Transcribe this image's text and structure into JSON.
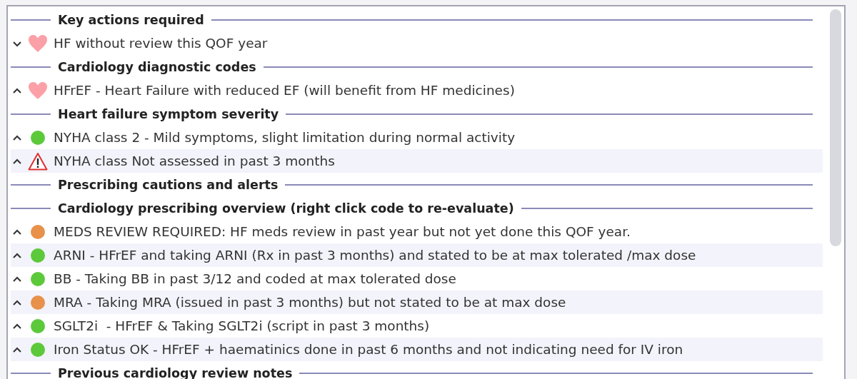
{
  "sections": [
    {
      "title": "Key actions required",
      "items": [
        {
          "text": "HF without review this QOF year",
          "expanded": false,
          "kind": "heart"
        }
      ]
    },
    {
      "title": "Cardiology diagnostic codes",
      "items": [
        {
          "text": "HFrEF - Heart Failure with reduced EF (will benefit from HF medicines)",
          "expanded": true,
          "kind": "heart"
        }
      ]
    },
    {
      "title": "Heart failure symptom severity",
      "items": [
        {
          "text": "NYHA class 2 - Mild symptoms, slight limitation during normal activity",
          "expanded": true,
          "kind": "dot",
          "color": "#5cc93a"
        },
        {
          "text": "NYHA class Not assessed in past 3 months",
          "expanded": true,
          "kind": "warning"
        }
      ]
    },
    {
      "title": "Prescribing cautions and alerts"
    },
    {
      "title": "Cardiology prescribing overview (right click code to re-evaluate)",
      "items": [
        {
          "text": "MEDS REVIEW REQUIRED: HF meds review in past year but not yet done this QOF year.",
          "expanded": true,
          "kind": "dot",
          "color": "#e8914a"
        },
        {
          "text": "ARNI - HFrEF and taking ARNI (Rx in past 3 months) and stated to be at max tolerated /max dose",
          "expanded": true,
          "kind": "dot",
          "color": "#5cc93a"
        },
        {
          "text": "BB - Taking BB in past 3/12 and coded at max tolerated dose",
          "expanded": true,
          "kind": "dot",
          "color": "#5cc93a"
        },
        {
          "text": "MRA - Taking MRA (issued in past 3 months) but not stated to be at max dose",
          "expanded": true,
          "kind": "dot",
          "color": "#e8914a"
        },
        {
          "text": "SGLT2i  - HFrEF & Taking SGLT2i (script in past 3 months)",
          "expanded": true,
          "kind": "dot",
          "color": "#5cc93a"
        },
        {
          "text": "Iron Status OK - HFrEF + haematinics done in past 6 months and not indicating need for IV iron",
          "expanded": true,
          "kind": "dot",
          "color": "#5cc93a"
        }
      ]
    },
    {
      "title": "Previous cardiology review notes"
    }
  ]
}
